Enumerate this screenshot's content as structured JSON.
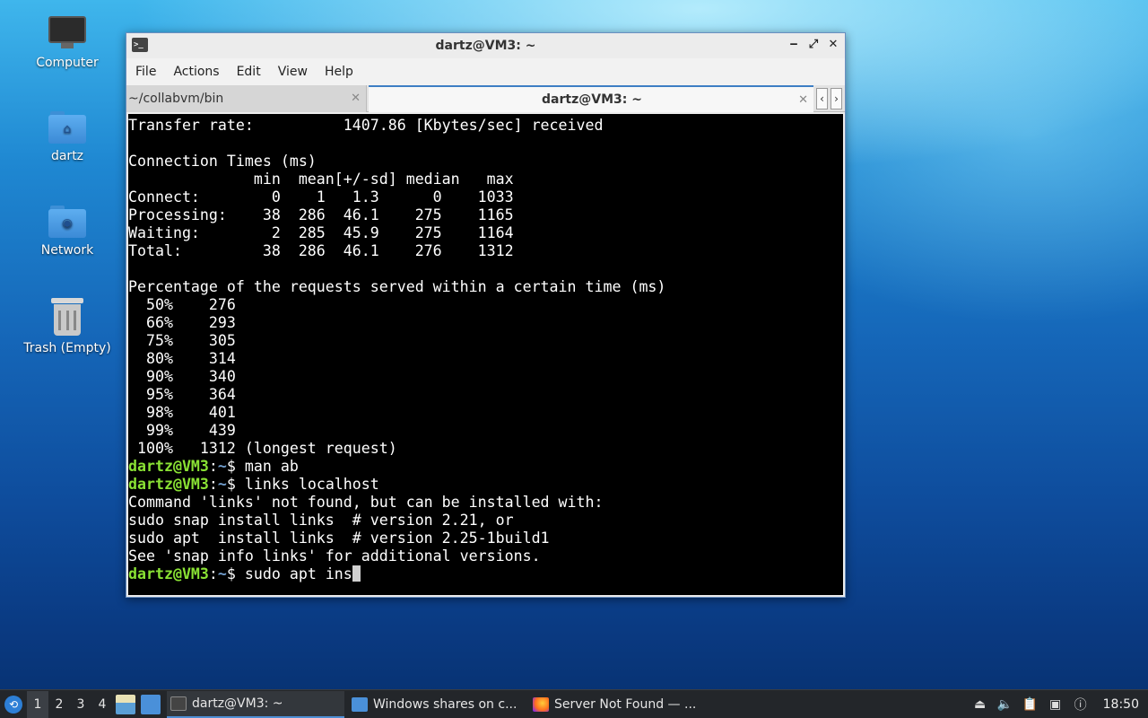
{
  "desktop": {
    "icons": [
      {
        "label": "Computer",
        "icon": "computer-icon"
      },
      {
        "label": "dartz",
        "icon": "home-folder-icon"
      },
      {
        "label": "Network",
        "icon": "network-folder-icon"
      },
      {
        "label": "Trash (Empty)",
        "icon": "trash-icon"
      }
    ]
  },
  "window": {
    "title": "dartz@VM3: ~",
    "controls": {
      "minimize": "‒",
      "maximize": "⤢",
      "close": "✕"
    },
    "menu": [
      "File",
      "Actions",
      "Edit",
      "View",
      "Help"
    ],
    "tabs": [
      {
        "label": "~/collabvm/bin",
        "close": "✕"
      },
      {
        "label": "dartz@VM3: ~",
        "close": "✕"
      }
    ],
    "tab_scroll": {
      "left": "‹",
      "right": "›"
    }
  },
  "terminal": {
    "lines": [
      "Transfer rate:          1407.86 [Kbytes/sec] received",
      "",
      "Connection Times (ms)",
      "              min  mean[+/-sd] median   max",
      "Connect:        0    1   1.3      0    1033",
      "Processing:    38  286  46.1    275    1165",
      "Waiting:        2  285  45.9    275    1164",
      "Total:         38  286  46.1    276    1312",
      "",
      "Percentage of the requests served within a certain time (ms)",
      "  50%    276",
      "  66%    293",
      "  75%    305",
      "  80%    314",
      "  90%    340",
      "  95%    364",
      "  98%    401",
      "  99%    439",
      " 100%   1312 (longest request)"
    ],
    "prompt": {
      "user_host": "dartz@VM3",
      "sep": ":",
      "path": "~",
      "symbol": "$ "
    },
    "commands": [
      {
        "cmd": "man ab",
        "output": []
      },
      {
        "cmd": "links localhost",
        "output": [
          "Command 'links' not found, but can be installed with:",
          "sudo snap install links  # version 2.21, or",
          "sudo apt  install links  # version 2.25-1build1",
          "See 'snap info links' for additional versions."
        ]
      }
    ],
    "current_input": "sudo apt ins"
  },
  "taskbar": {
    "desktops": [
      "1",
      "2",
      "3",
      "4"
    ],
    "active_desktop": "1",
    "tasks": [
      {
        "label": "dartz@VM3: ~",
        "icon": "terminal-icon"
      },
      {
        "label": "Windows shares on c...",
        "icon": "folder-icon"
      },
      {
        "label": "Server Not Found — ...",
        "icon": "firefox-icon"
      }
    ],
    "tray_icons": [
      "eject-icon",
      "volume-icon",
      "clipboard-icon",
      "network-icon",
      "update-icon"
    ],
    "clock": "18:50"
  },
  "colors": {
    "prompt_user": "#8ae234",
    "prompt_path": "#729fcf",
    "terminal_bg": "#000000",
    "taskbar_bg": "#23262a"
  }
}
